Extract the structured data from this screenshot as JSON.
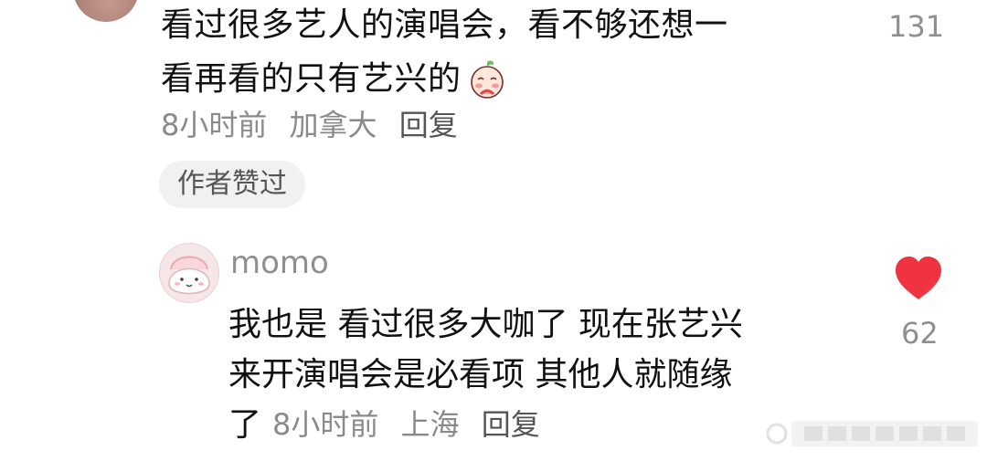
{
  "comment": {
    "line1": "看过很多艺人的演唱会，看不够还想一",
    "line2": "看再看的只有艺兴的",
    "emoji_icon": "blushing-face-emoji-icon",
    "time": "8小时前",
    "location": "加拿大",
    "reply_label": "回复",
    "likes": "131",
    "author_liked_badge": "作者赞过"
  },
  "reply": {
    "username": "momo",
    "line1": "我也是 看过很多大咖了 现在张艺兴",
    "line2": "来开演唱会是必看项 其他人就随缘",
    "line3": "了",
    "time": "8小时前",
    "location": "上海",
    "reply_label": "回复",
    "likes": "62",
    "heart_icon": "heart-filled-icon",
    "heart_color": "#ef3340"
  }
}
